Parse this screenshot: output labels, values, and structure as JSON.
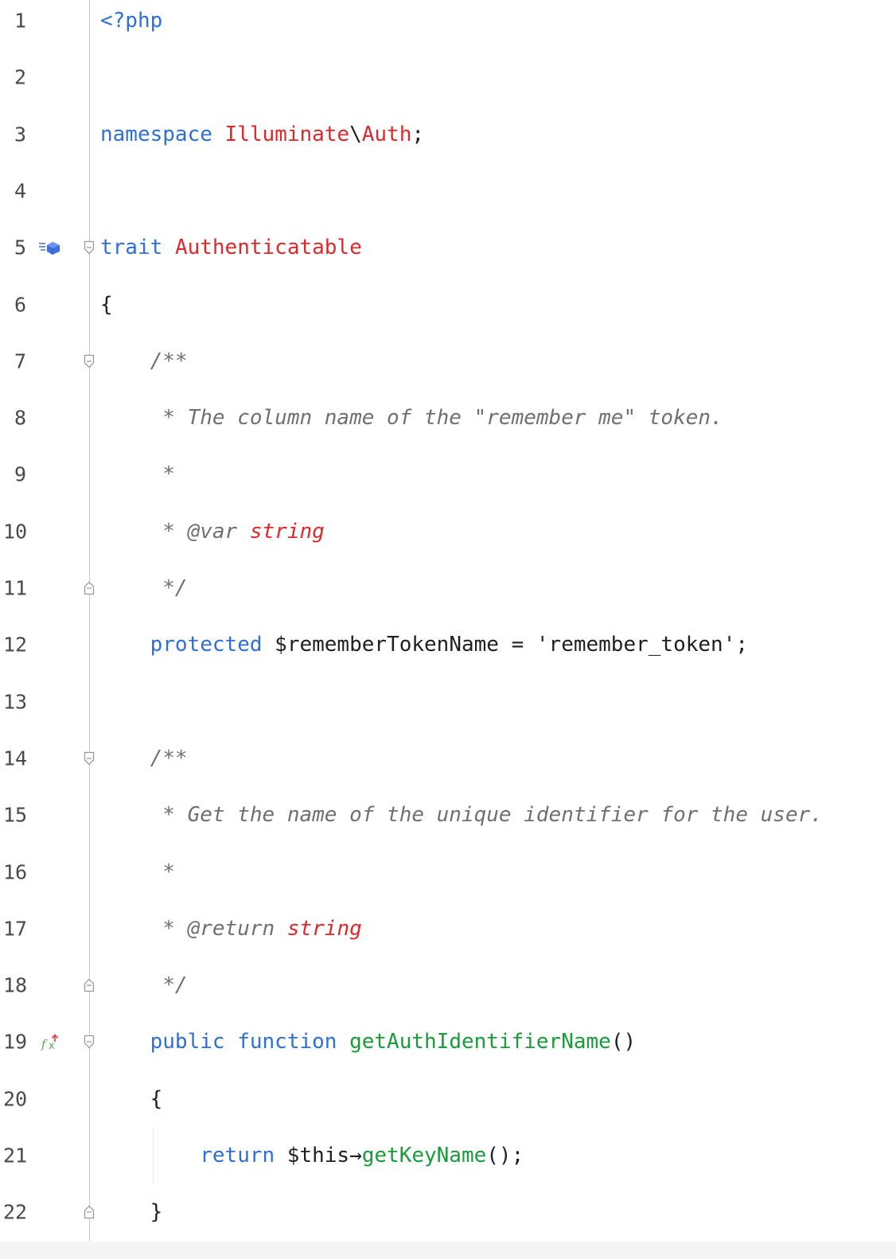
{
  "editor": {
    "lines": [
      {
        "num": "1",
        "parts": [
          {
            "t": "<?php",
            "c": "kw"
          }
        ]
      },
      {
        "num": "2",
        "parts": []
      },
      {
        "num": "3",
        "parts": [
          {
            "t": "namespace",
            "c": "kw"
          },
          {
            "t": " ",
            "c": ""
          },
          {
            "t": "Illuminate",
            "c": "cls"
          },
          {
            "t": "\\",
            "c": ""
          },
          {
            "t": "Auth",
            "c": "cls"
          },
          {
            "t": ";",
            "c": ""
          }
        ]
      },
      {
        "num": "4",
        "parts": []
      },
      {
        "num": "5",
        "parts": [
          {
            "t": "trait",
            "c": "kw"
          },
          {
            "t": " ",
            "c": ""
          },
          {
            "t": "Authenticatable",
            "c": "cls"
          }
        ],
        "gutter_icon": "trait-implemented-icon",
        "fold": "open"
      },
      {
        "num": "6",
        "parts": [
          {
            "t": "{",
            "c": ""
          }
        ]
      },
      {
        "num": "7",
        "parts": [
          {
            "t": "    ",
            "c": ""
          },
          {
            "t": "/**",
            "c": "cm"
          }
        ],
        "fold": "open"
      },
      {
        "num": "8",
        "parts": [
          {
            "t": "     ",
            "c": ""
          },
          {
            "t": "* The column name of the \"remember me\" token.",
            "c": "cm"
          }
        ]
      },
      {
        "num": "9",
        "parts": [
          {
            "t": "     ",
            "c": ""
          },
          {
            "t": "*",
            "c": "cm"
          }
        ]
      },
      {
        "num": "10",
        "parts": [
          {
            "t": "     ",
            "c": ""
          },
          {
            "t": "* @var ",
            "c": "cm"
          },
          {
            "t": "string",
            "c": "cmtype"
          }
        ]
      },
      {
        "num": "11",
        "parts": [
          {
            "t": "     ",
            "c": ""
          },
          {
            "t": "*/",
            "c": "cm"
          }
        ],
        "fold": "close"
      },
      {
        "num": "12",
        "parts": [
          {
            "t": "    ",
            "c": ""
          },
          {
            "t": "protected",
            "c": "kw"
          },
          {
            "t": " $rememberTokenName = ",
            "c": ""
          },
          {
            "t": "'remember_token'",
            "c": "str"
          },
          {
            "t": ";",
            "c": ""
          }
        ]
      },
      {
        "num": "13",
        "parts": []
      },
      {
        "num": "14",
        "parts": [
          {
            "t": "    ",
            "c": ""
          },
          {
            "t": "/**",
            "c": "cm"
          }
        ],
        "fold": "open"
      },
      {
        "num": "15",
        "parts": [
          {
            "t": "     ",
            "c": ""
          },
          {
            "t": "* Get the name of the unique identifier for the user.",
            "c": "cm"
          }
        ]
      },
      {
        "num": "16",
        "parts": [
          {
            "t": "     ",
            "c": ""
          },
          {
            "t": "*",
            "c": "cm"
          }
        ]
      },
      {
        "num": "17",
        "parts": [
          {
            "t": "     ",
            "c": ""
          },
          {
            "t": "* @return ",
            "c": "cm"
          },
          {
            "t": "string",
            "c": "cmtype"
          }
        ]
      },
      {
        "num": "18",
        "parts": [
          {
            "t": "     ",
            "c": ""
          },
          {
            "t": "*/",
            "c": "cm"
          }
        ],
        "fold": "close"
      },
      {
        "num": "19",
        "parts": [
          {
            "t": "    ",
            "c": ""
          },
          {
            "t": "public",
            "c": "kw"
          },
          {
            "t": " ",
            "c": ""
          },
          {
            "t": "function",
            "c": "kw"
          },
          {
            "t": " ",
            "c": ""
          },
          {
            "t": "getAuthIdentifierName",
            "c": "fn"
          },
          {
            "t": "()",
            "c": ""
          }
        ],
        "gutter_icon": "implements-method-icon",
        "fold": "open"
      },
      {
        "num": "20",
        "parts": [
          {
            "t": "    {",
            "c": ""
          }
        ]
      },
      {
        "num": "21",
        "parts": [
          {
            "t": "        ",
            "c": ""
          },
          {
            "t": "return",
            "c": "kw"
          },
          {
            "t": " $this",
            "c": ""
          },
          {
            "t": "→",
            "c": ""
          },
          {
            "t": "getKeyName",
            "c": "fn"
          },
          {
            "t": "();",
            "c": ""
          }
        ]
      },
      {
        "num": "22",
        "parts": [
          {
            "t": "    }",
            "c": ""
          }
        ],
        "fold": "close"
      }
    ]
  },
  "colors": {
    "keyword": "#2f6fd6",
    "class_name": "#e0282c",
    "function_name": "#1a9b3a",
    "comment": "#707070",
    "line_number": "#4a4a4a"
  }
}
